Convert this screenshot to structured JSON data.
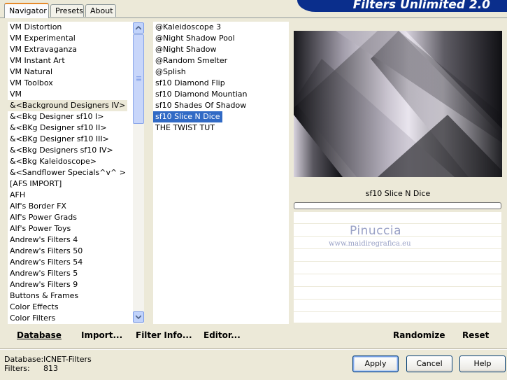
{
  "tabs": [
    {
      "label": "Navigator",
      "active": true
    },
    {
      "label": "Presets",
      "active": false
    },
    {
      "label": "About",
      "active": false
    }
  ],
  "header": {
    "title": "Filters Unlimited 2.0"
  },
  "categories": {
    "items": [
      "VM Distortion",
      "VM Experimental",
      "VM Extravaganza",
      "VM Instant Art",
      "VM Natural",
      "VM Toolbox",
      "VM",
      "&<Background Designers IV>",
      "&<Bkg Designer sf10 I>",
      "&<BKg Designer sf10 II>",
      "&<BKg Designer sf10 III>",
      "&<Bkg Designers sf10 IV>",
      "&<Bkg Kaleidoscope>",
      "&<Sandflower Specials^v^ >",
      "[AFS IMPORT]",
      "AFH",
      "Alf's Border FX",
      "Alf's Power Grads",
      "Alf's Power Toys",
      "Andrew's Filters 4",
      "Andrew's Filters 50",
      "Andrew's Filters 54",
      "Andrew's Filters 5",
      "Andrew's Filters 9",
      "Buttons & Frames",
      "Color Effects",
      "Color Filters"
    ],
    "highlighted_index": 7
  },
  "filters": {
    "items": [
      "@Kaleidoscope 3",
      "@Night Shadow Pool",
      "@Night Shadow",
      "@Random Smelter",
      "@Splish",
      "sf10 Diamond Flip",
      "sf10 Diamond Mountian",
      "sf10 Shades Of Shadow",
      "sf10 Slice N Dice",
      "THE TWIST TUT"
    ],
    "selected_index": 8
  },
  "preview": {
    "filter_name": "sf10 Slice N Dice",
    "watermark_name": "Pinuccia",
    "watermark_url": "www.maidiregrafica.eu"
  },
  "actions": {
    "database": "Database",
    "import": "Import...",
    "filter_info": "Filter Info...",
    "editor": "Editor...",
    "randomize": "Randomize",
    "reset": "Reset"
  },
  "status": {
    "database_label": "Database:",
    "database_value": "ICNET-Filters",
    "filters_label": "Filters:",
    "filters_value": "813"
  },
  "buttons": {
    "apply": "Apply",
    "cancel": "Cancel",
    "help": "Help"
  },
  "colors": {
    "selection": "#316ac5",
    "banner": "#0a2e8c",
    "window_bg": "#ece9d8"
  }
}
